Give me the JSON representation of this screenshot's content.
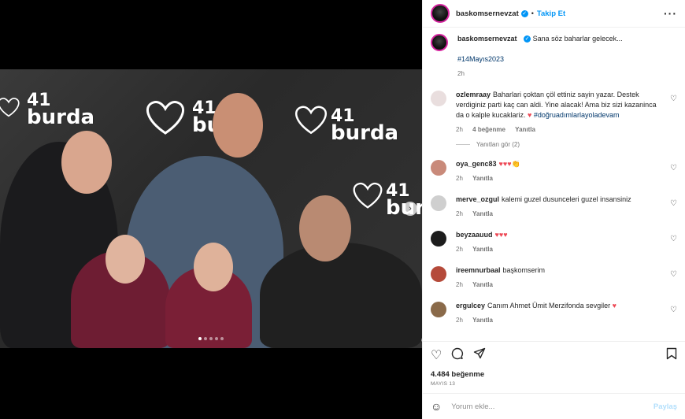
{
  "post": {
    "username": "baskomsernevzat",
    "follow_label": "Takip Et",
    "separator": "•",
    "caption": "Sana söz baharlar gelecek... ",
    "caption_hashtag": "#14Mayıs2023",
    "caption_time": "2h",
    "likes": "4.484 beğenme",
    "date": "MAYIS 13"
  },
  "wall": {
    "number": "41",
    "word": "burda"
  },
  "comments": [
    {
      "user": "ozlemraay",
      "text": "Baharlari çoktan çöl ettiniz sayin yazar. Destek verdiginiz parti kaç can aldi. Yine alacak! Ama biz sizi kazaninca da o kalple kucaklariz. ",
      "heart": "♥",
      "hashtag": "#doğruadımlarlayoladevam",
      "time": "2h",
      "likes": "4 beğenme",
      "reply": "Yanıtla",
      "view_replies": "Yanıtları gör (2)",
      "avatar_color": "#e9dede"
    },
    {
      "user": "oya_genc83",
      "text": "♥♥♥👏",
      "time": "2h",
      "reply": "Yanıtla",
      "avatar_color": "#c98a7a"
    },
    {
      "user": "merve_ozgul",
      "text": "kalemi guzel dusunceleri guzel insansiniz ",
      "time": "2h",
      "reply": "Yanıtla",
      "avatar_color": "#cfcfcf"
    },
    {
      "user": "beyzaauud",
      "text": "♥♥♥",
      "time": "2h",
      "reply": "Yanıtla",
      "avatar_color": "#1d1d1d"
    },
    {
      "user": "ireemnurbaal",
      "text": "başkomserim",
      "time": "2h",
      "reply": "Yanıtla",
      "avatar_color": "#b54a3a"
    },
    {
      "user": "ergulcey",
      "text": "Canım Ahmet Ümit Merzifonda sevgiler ",
      "heart": "♥",
      "time": "2h",
      "reply": "Yanıtla",
      "avatar_color": "#8a6a4a"
    }
  ],
  "add_comment": {
    "placeholder": "Yorum ekle...",
    "post_label": "Paylaş"
  },
  "icons": {
    "like": "heart-icon",
    "comment": "comment-icon",
    "share": "share-icon",
    "save": "bookmark-icon",
    "more": "more-icon",
    "emoji": "emoji-icon"
  },
  "colors": {
    "accent": "#0095f6",
    "heart": "#ed4956",
    "hashtag": "#00376b"
  }
}
